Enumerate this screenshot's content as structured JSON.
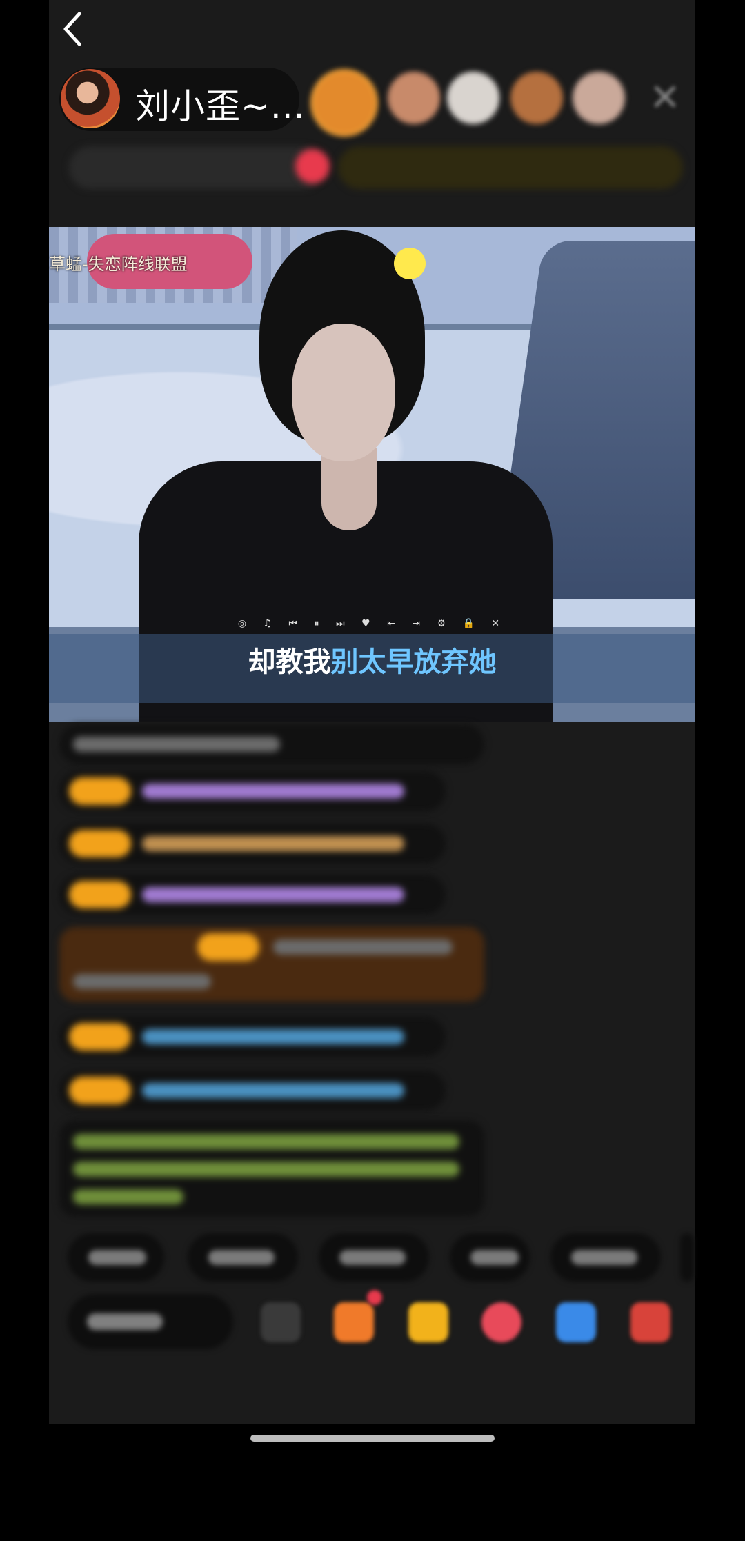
{
  "header": {
    "host_name": "刘小歪~...",
    "back_icon": "chevron-left-icon",
    "close_icon": "close-icon"
  },
  "video": {
    "overlay_text": "草蜢-失恋阵线联盟",
    "lyric_sung": "却教我",
    "lyric_unsung": "别太早放弃她",
    "player_controls": "◎ ♫ ⏮ ⏸ ⏭ ♥ ⇤ ⇥ ⚙ 🔒 ✕"
  },
  "colors": {
    "background": "#1b1b1b",
    "badge": "#f2a21b",
    "lyric_highlight": "#6fc6ff",
    "accent_red": "#e83a4d"
  }
}
